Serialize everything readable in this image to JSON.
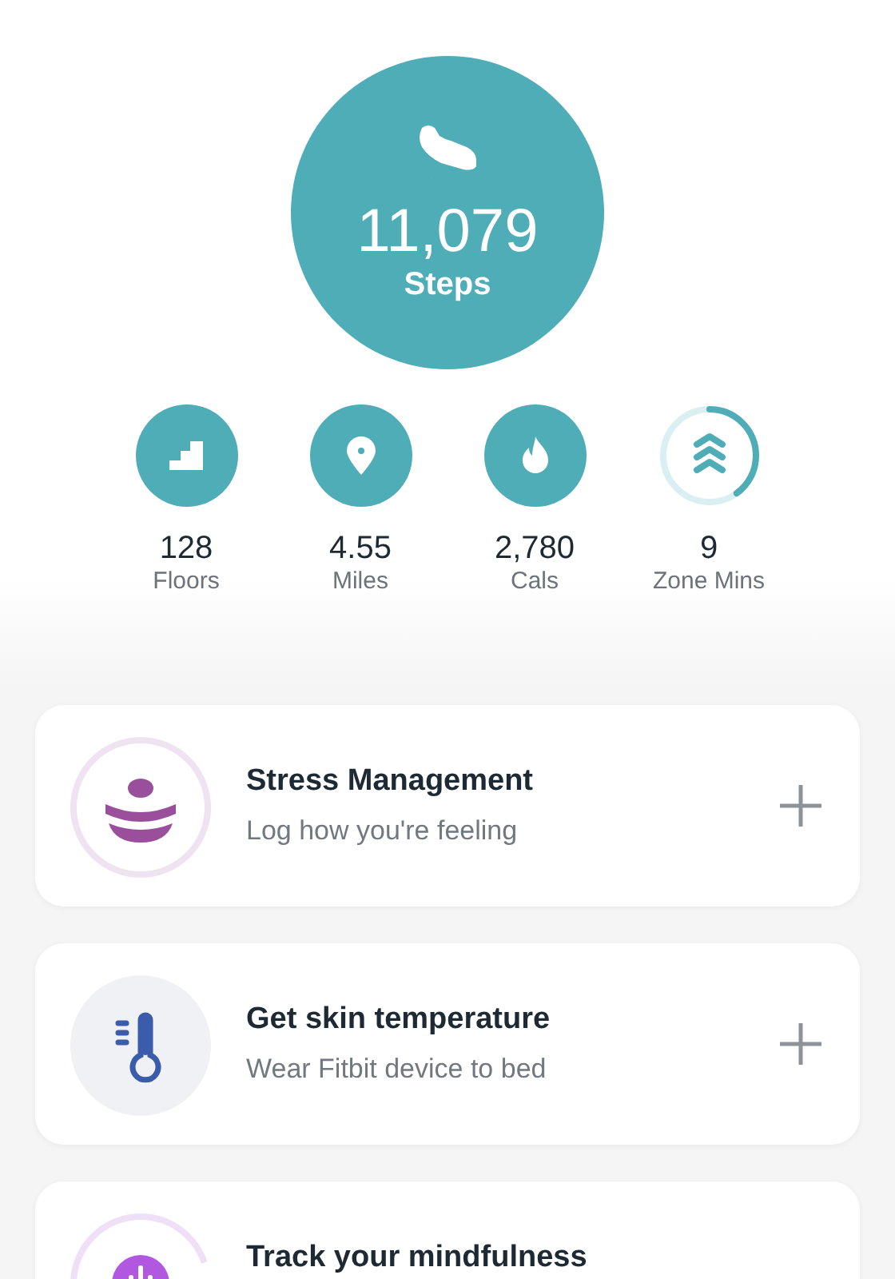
{
  "steps": {
    "value": "11,079",
    "label": "Steps"
  },
  "stats": [
    {
      "kind": "floors",
      "value": "128",
      "label": "Floors"
    },
    {
      "kind": "miles",
      "value": "4.55",
      "label": "Miles"
    },
    {
      "kind": "cals",
      "value": "2,780",
      "label": "Cals"
    },
    {
      "kind": "zone",
      "value": "9",
      "label": "Zone Mins",
      "level": 0.4
    }
  ],
  "cards": [
    {
      "kind": "stress",
      "title": "Stress Management",
      "subtitle": "Log how you're feeling"
    },
    {
      "kind": "temperature",
      "title": "Get skin temperature",
      "subtitle": "Wear Fitbit device to bed"
    },
    {
      "kind": "mindfulness",
      "title": "Track your mindfulness"
    }
  ]
}
